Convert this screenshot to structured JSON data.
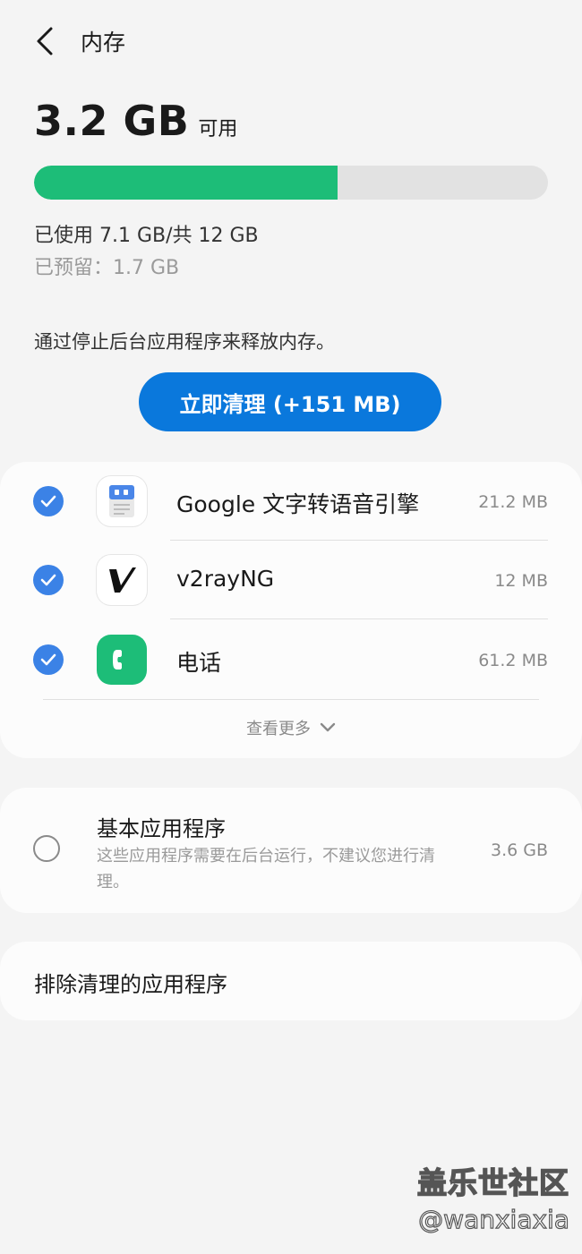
{
  "header": {
    "title": "内存",
    "back_icon": "chevron-left-icon"
  },
  "memory": {
    "available_value": "3.2 GB",
    "available_label": "可用",
    "used_fraction": 0.59,
    "used_text": "已使用 7.1 GB/共 12 GB",
    "reserved_text": "已预留：1.7 GB"
  },
  "description": "通过停止后台应用程序来释放内存。",
  "clean_button": {
    "label": "立即清理 (+151 MB)"
  },
  "apps": [
    {
      "name": "Google 文字转语音引擎",
      "size": "21.2 MB",
      "checked": true,
      "icon": "google-tts-icon"
    },
    {
      "name": "v2rayNG",
      "size": "12 MB",
      "checked": true,
      "icon": "v2rayng-icon"
    },
    {
      "name": "电话",
      "size": "61.2 MB",
      "checked": true,
      "icon": "phone-icon"
    }
  ],
  "more": {
    "label": "查看更多",
    "icon": "chevron-down-icon"
  },
  "basic_apps": {
    "title": "基本应用程序",
    "description": "这些应用程序需要在后台运行，不建议您进行清理。",
    "size": "3.6 GB",
    "checked": false
  },
  "exclude": {
    "label": "排除清理的应用程序"
  },
  "watermark": {
    "line1": "盖乐世社区",
    "line2": "@wanxiaxia"
  },
  "colors": {
    "accent": "#0a78dc",
    "bar_fill": "#1dbd78",
    "check": "#3b82e6",
    "phone_icon": "#1dbd78"
  }
}
